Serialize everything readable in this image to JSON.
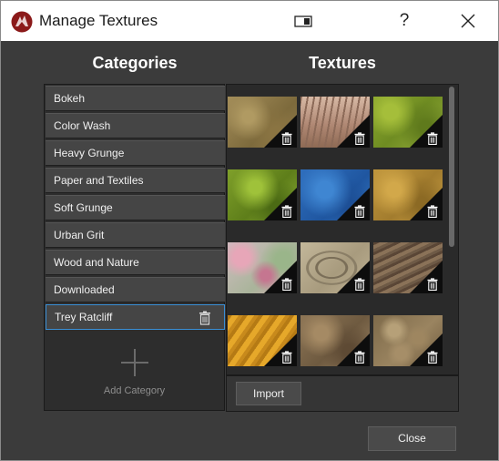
{
  "window": {
    "title": "Manage Textures",
    "help_label": "?"
  },
  "categories": {
    "heading": "Categories",
    "items": [
      {
        "label": "Bokeh"
      },
      {
        "label": "Color Wash"
      },
      {
        "label": "Heavy Grunge"
      },
      {
        "label": "Paper and Textiles"
      },
      {
        "label": "Soft Grunge"
      },
      {
        "label": "Urban Grit"
      },
      {
        "label": "Wood and Nature"
      },
      {
        "label": "Downloaded"
      },
      {
        "label": "Trey Ratcliff",
        "selected": true
      }
    ],
    "add_label": "Add Category"
  },
  "textures": {
    "heading": "Textures",
    "import_label": "Import",
    "thumbnails": [
      {
        "name": "sandy-brown"
      },
      {
        "name": "bare-trees"
      },
      {
        "name": "green-moss"
      },
      {
        "name": "green-grunge"
      },
      {
        "name": "blue-paint"
      },
      {
        "name": "golden-stone"
      },
      {
        "name": "pink-bokeh"
      },
      {
        "name": "stone-carving"
      },
      {
        "name": "tree-bark"
      },
      {
        "name": "orange-leaf"
      },
      {
        "name": "brown-rock"
      },
      {
        "name": "carved-relief"
      }
    ]
  },
  "footer": {
    "close_label": "Close"
  },
  "colors": {
    "selection": "#3a8fd6",
    "background": "#3b3b3b",
    "panel": "#2d2d2d"
  }
}
